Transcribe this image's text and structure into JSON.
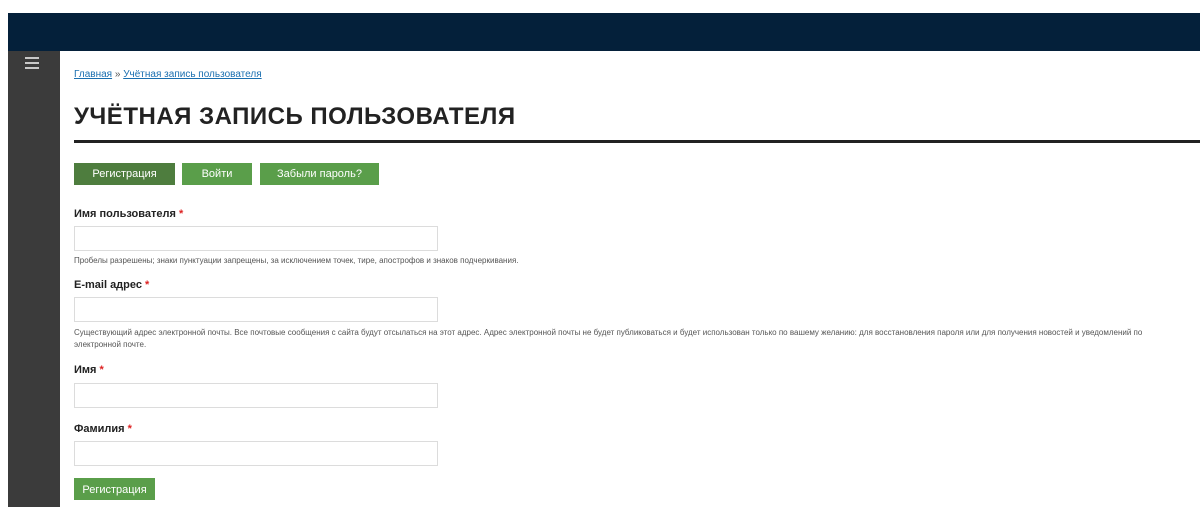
{
  "breadcrumb": {
    "home": "Главная",
    "separator": " » ",
    "current": "Учётная запись пользователя"
  },
  "page": {
    "title": "УЧЁТНАЯ ЗАПИСЬ ПОЛЬЗОВАТЕЛЯ"
  },
  "tabs": [
    {
      "label": "Регистрация",
      "active": true
    },
    {
      "label": "Войти",
      "active": false
    },
    {
      "label": "Забыли пароль?",
      "active": false
    }
  ],
  "form": {
    "required_marker": "*",
    "username": {
      "label": "Имя пользователя",
      "value": "",
      "help": "Пробелы разрешены; знаки пунктуации запрещены, за исключением точек, тире, апострофов и знаков подчеркивания."
    },
    "email": {
      "label": "E-mail адрес",
      "value": "",
      "help_line1": "Существующий адрес электронной почты. Все почтовые сообщения с сайта будут отсылаться на этот адрес. Адрес электронной почты не будет публиковаться и будет использован только по вашему желанию: для восстановления пароля или для получения новостей и уведомлений по",
      "help_line2": "электронной почте."
    },
    "first_name": {
      "label": "Имя",
      "value": ""
    },
    "last_name": {
      "label": "Фамилия",
      "value": ""
    },
    "submit_label": "Регистрация"
  },
  "colors": {
    "topbar": "#04203a",
    "sidebar": "#3b3b3b",
    "button_green": "#5a9e4a",
    "active_tab": "#4e7d3e",
    "required": "#dd2222",
    "link": "#1a6fb0"
  },
  "icons": {
    "menu": "hamburger-menu-icon"
  }
}
